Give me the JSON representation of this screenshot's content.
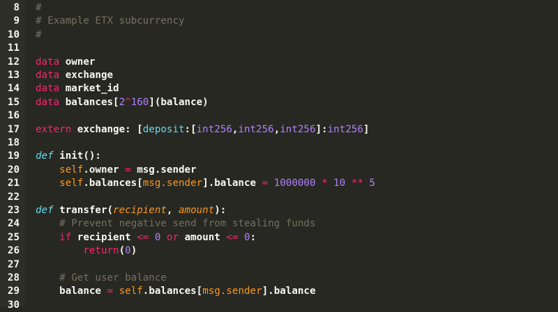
{
  "editor": {
    "theme_colors": {
      "background": "#272822",
      "plain": "#f8f8f2",
      "comment": "#75715e",
      "keyword": "#f92672",
      "def": "#66d9ef",
      "number": "#ae81ff",
      "param": "#fd971f"
    },
    "lines": [
      {
        "num": "8",
        "tokens": [
          {
            "t": "#",
            "c": "comment"
          }
        ]
      },
      {
        "num": "9",
        "tokens": [
          {
            "t": "# Example ETX subcurrency",
            "c": "comment"
          }
        ]
      },
      {
        "num": "10",
        "tokens": [
          {
            "t": "#",
            "c": "comment"
          }
        ]
      },
      {
        "num": "11",
        "tokens": []
      },
      {
        "num": "12",
        "tokens": [
          {
            "t": "data",
            "c": "keyword"
          },
          {
            "t": " owner",
            "c": "plain"
          }
        ]
      },
      {
        "num": "13",
        "tokens": [
          {
            "t": "data",
            "c": "keyword"
          },
          {
            "t": " exchange",
            "c": "plain"
          }
        ]
      },
      {
        "num": "14",
        "tokens": [
          {
            "t": "data",
            "c": "keyword"
          },
          {
            "t": " market_id",
            "c": "plain"
          }
        ]
      },
      {
        "num": "15",
        "tokens": [
          {
            "t": "data",
            "c": "keyword"
          },
          {
            "t": " balances[",
            "c": "plain"
          },
          {
            "t": "2",
            "c": "number"
          },
          {
            "t": "^",
            "c": "operator"
          },
          {
            "t": "160",
            "c": "number"
          },
          {
            "t": "](balance)",
            "c": "plain"
          }
        ]
      },
      {
        "num": "16",
        "tokens": []
      },
      {
        "num": "17",
        "tokens": [
          {
            "t": "extern",
            "c": "keyword"
          },
          {
            "t": " exchange: [",
            "c": "plain"
          },
          {
            "t": "deposit",
            "c": "builtin"
          },
          {
            "t": ":[",
            "c": "plain"
          },
          {
            "t": "int256",
            "c": "type"
          },
          {
            "t": ",",
            "c": "plain"
          },
          {
            "t": "int256",
            "c": "type"
          },
          {
            "t": ",",
            "c": "plain"
          },
          {
            "t": "int256",
            "c": "type"
          },
          {
            "t": "]:",
            "c": "plain"
          },
          {
            "t": "int256",
            "c": "type"
          },
          {
            "t": "]",
            "c": "plain"
          }
        ]
      },
      {
        "num": "18",
        "tokens": []
      },
      {
        "num": "19",
        "tokens": [
          {
            "t": "def",
            "c": "def"
          },
          {
            "t": " init",
            "c": "plain"
          },
          {
            "t": "():",
            "c": "plain"
          }
        ]
      },
      {
        "num": "20",
        "tokens": [
          {
            "t": "    ",
            "c": "plain"
          },
          {
            "t": "self",
            "c": "self"
          },
          {
            "t": ".owner ",
            "c": "plain"
          },
          {
            "t": "=",
            "c": "operator"
          },
          {
            "t": " msg.sender",
            "c": "plain"
          }
        ]
      },
      {
        "num": "21",
        "tokens": [
          {
            "t": "    ",
            "c": "plain"
          },
          {
            "t": "self",
            "c": "self"
          },
          {
            "t": ".balances[",
            "c": "plain"
          },
          {
            "t": "msg.sender",
            "c": "self"
          },
          {
            "t": "].balance ",
            "c": "plain"
          },
          {
            "t": "=",
            "c": "operator"
          },
          {
            "t": " ",
            "c": "plain"
          },
          {
            "t": "1000000",
            "c": "number"
          },
          {
            "t": " ",
            "c": "plain"
          },
          {
            "t": "*",
            "c": "operator"
          },
          {
            "t": " ",
            "c": "plain"
          },
          {
            "t": "10",
            "c": "number"
          },
          {
            "t": " ",
            "c": "plain"
          },
          {
            "t": "**",
            "c": "operator"
          },
          {
            "t": " ",
            "c": "plain"
          },
          {
            "t": "5",
            "c": "number"
          }
        ]
      },
      {
        "num": "22",
        "tokens": []
      },
      {
        "num": "23",
        "tokens": [
          {
            "t": "def",
            "c": "def"
          },
          {
            "t": " transfer",
            "c": "plain"
          },
          {
            "t": "(",
            "c": "plain"
          },
          {
            "t": "recipient",
            "c": "param"
          },
          {
            "t": ", ",
            "c": "plain"
          },
          {
            "t": "amount",
            "c": "param"
          },
          {
            "t": "):",
            "c": "plain"
          }
        ]
      },
      {
        "num": "24",
        "tokens": [
          {
            "t": "    ",
            "c": "plain"
          },
          {
            "t": "# Prevent negative send from stealing funds",
            "c": "comment"
          }
        ]
      },
      {
        "num": "25",
        "tokens": [
          {
            "t": "    ",
            "c": "plain"
          },
          {
            "t": "if",
            "c": "keyword"
          },
          {
            "t": " recipient ",
            "c": "plain"
          },
          {
            "t": "<=",
            "c": "operator"
          },
          {
            "t": " ",
            "c": "plain"
          },
          {
            "t": "0",
            "c": "number"
          },
          {
            "t": " ",
            "c": "plain"
          },
          {
            "t": "or",
            "c": "keyword"
          },
          {
            "t": " amount ",
            "c": "plain"
          },
          {
            "t": "<=",
            "c": "operator"
          },
          {
            "t": " ",
            "c": "plain"
          },
          {
            "t": "0",
            "c": "number"
          },
          {
            "t": ":",
            "c": "plain"
          }
        ]
      },
      {
        "num": "26",
        "tokens": [
          {
            "t": "        ",
            "c": "plain"
          },
          {
            "t": "return",
            "c": "keyword"
          },
          {
            "t": "(",
            "c": "plain"
          },
          {
            "t": "0",
            "c": "number"
          },
          {
            "t": ")",
            "c": "plain"
          }
        ]
      },
      {
        "num": "27",
        "tokens": []
      },
      {
        "num": "28",
        "tokens": [
          {
            "t": "    ",
            "c": "plain"
          },
          {
            "t": "# Get user balance",
            "c": "comment"
          }
        ]
      },
      {
        "num": "29",
        "tokens": [
          {
            "t": "    ",
            "c": "plain"
          },
          {
            "t": "balance ",
            "c": "plain"
          },
          {
            "t": "=",
            "c": "operator"
          },
          {
            "t": " ",
            "c": "plain"
          },
          {
            "t": "self",
            "c": "self"
          },
          {
            "t": ".balances[",
            "c": "plain"
          },
          {
            "t": "msg.sender",
            "c": "self"
          },
          {
            "t": "].balance",
            "c": "plain"
          }
        ]
      },
      {
        "num": "30",
        "tokens": []
      }
    ]
  }
}
